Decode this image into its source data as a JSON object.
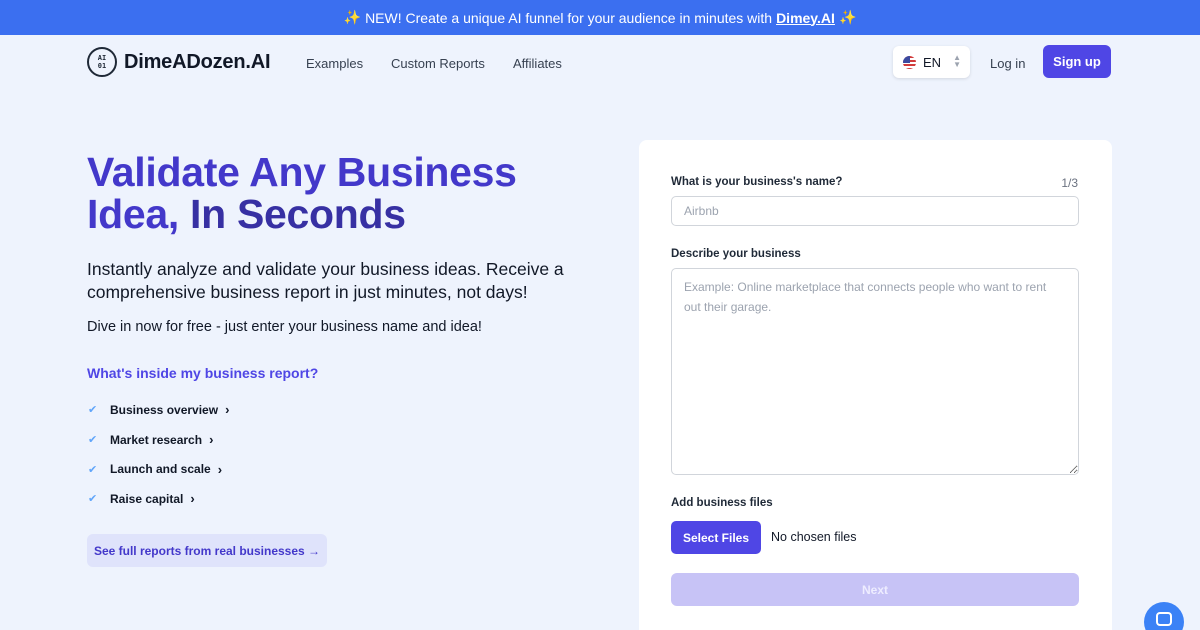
{
  "banner": {
    "sparkle_left": "✨",
    "text": "NEW! Create a unique AI funnel for your audience in minutes with",
    "link": "Dimey.AI",
    "sparkle_right": "✨"
  },
  "nav": {
    "logo_text": "DimeADozen.AI",
    "logo_mark_top": "AI",
    "logo_mark_bottom": "01",
    "links": [
      "Examples",
      "Custom Reports",
      "Affiliates"
    ],
    "language": "EN",
    "login": "Log in",
    "signup": "Sign up"
  },
  "hero": {
    "title_line1": "Validate Any Business",
    "title_line2_plain": "Idea,",
    "title_line2_accent": "In Seconds",
    "subtitle": "Instantly analyze and validate your business ideas. Receive a comprehensive business report in just minutes, not days!",
    "subtitle2": "Dive in now for free - just enter your business name and idea!",
    "inside_heading": "What's inside my business report?",
    "checklist": [
      "Business overview",
      "Market research",
      "Launch and scale",
      "Raise capital"
    ],
    "full_reports": "See full reports from real businesses →"
  },
  "form": {
    "name_label": "What is your business's name?",
    "step": "1/3",
    "name_placeholder": "Airbnb",
    "name_value": "",
    "describe_label": "Describe your business",
    "describe_placeholder": "Example: Online marketplace that connects people who want to rent out their garage.",
    "describe_value": "",
    "files_label": "Add business files",
    "select_files": "Select Files",
    "no_files": "No chosen files",
    "next": "Next"
  },
  "colors": {
    "banner": "#3b6ff0",
    "primary": "#4f46e5",
    "title": "#4338ca",
    "page_bg": "#eef3fd"
  },
  "icons": {
    "check": "checkmark-icon",
    "chevron": "chevron-right-icon",
    "flag": "us-flag-icon",
    "chat": "chat-launcher-icon"
  }
}
